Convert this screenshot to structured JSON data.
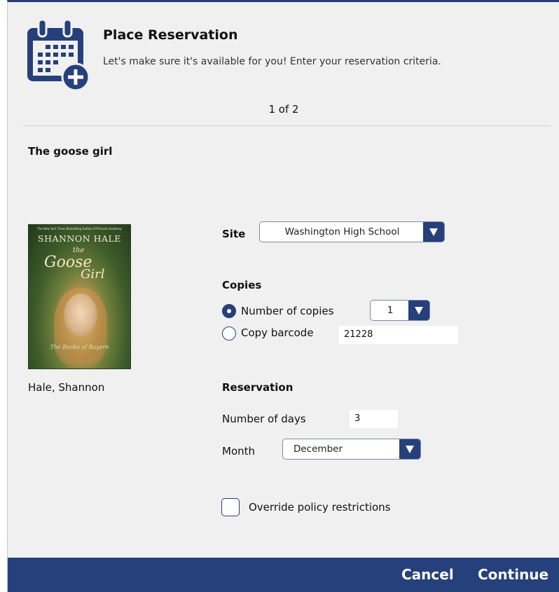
{
  "header": {
    "title": "Place Reservation",
    "subtitle": "Let's make sure it's available for you! Enter your reservation criteria.",
    "icon": "calendar-add-icon"
  },
  "pager": "1 of 2",
  "item": {
    "title": "The goose girl",
    "author": "Hale, Shannon",
    "cover": {
      "tagline": "The New York Times Bestselling Author of Princess Academy",
      "author_text": "SHANNON HALE",
      "title_words": [
        "the",
        "Goose",
        "Girl"
      ],
      "series_text": "The Books of Bayern"
    }
  },
  "form": {
    "site_label": "Site",
    "site_value": "Washington High School",
    "copies_heading": "Copies",
    "number_of_copies_label": "Number of copies",
    "number_of_copies_value": "1",
    "copy_barcode_label": "Copy barcode",
    "copy_barcode_value": "21228",
    "selected_copy_option": "Number of copies",
    "reservation_heading": "Reservation",
    "number_of_days_label": "Number of days",
    "number_of_days_value": "3",
    "month_label": "Month",
    "month_value": "December",
    "override_label": "Override policy restrictions",
    "override_checked": false
  },
  "footer": {
    "cancel_label": "Cancel",
    "continue_label": "Continue"
  },
  "colors": {
    "accent": "#25407a",
    "dialog_background": "#f0f0f0"
  }
}
